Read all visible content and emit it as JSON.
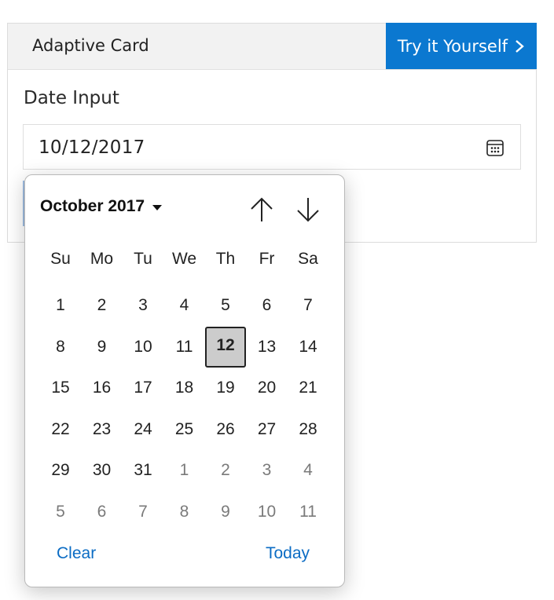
{
  "card": {
    "title": "Adaptive Card",
    "try_button": "Try it Yourself",
    "field_label": "Date Input",
    "date_value": "10/12/2017"
  },
  "picker": {
    "month_title": "October 2017",
    "weekdays": [
      "Su",
      "Mo",
      "Tu",
      "We",
      "Th",
      "Fr",
      "Sa"
    ],
    "days": [
      {
        "label": "1",
        "other": false
      },
      {
        "label": "2",
        "other": false
      },
      {
        "label": "3",
        "other": false
      },
      {
        "label": "4",
        "other": false
      },
      {
        "label": "5",
        "other": false
      },
      {
        "label": "6",
        "other": false
      },
      {
        "label": "7",
        "other": false
      },
      {
        "label": "8",
        "other": false
      },
      {
        "label": "9",
        "other": false
      },
      {
        "label": "10",
        "other": false
      },
      {
        "label": "11",
        "other": false
      },
      {
        "label": "12",
        "other": false,
        "selected": true
      },
      {
        "label": "13",
        "other": false
      },
      {
        "label": "14",
        "other": false
      },
      {
        "label": "15",
        "other": false
      },
      {
        "label": "16",
        "other": false
      },
      {
        "label": "17",
        "other": false
      },
      {
        "label": "18",
        "other": false
      },
      {
        "label": "19",
        "other": false
      },
      {
        "label": "20",
        "other": false
      },
      {
        "label": "21",
        "other": false
      },
      {
        "label": "22",
        "other": false
      },
      {
        "label": "23",
        "other": false
      },
      {
        "label": "24",
        "other": false
      },
      {
        "label": "25",
        "other": false
      },
      {
        "label": "26",
        "other": false
      },
      {
        "label": "27",
        "other": false
      },
      {
        "label": "28",
        "other": false
      },
      {
        "label": "29",
        "other": false
      },
      {
        "label": "30",
        "other": false
      },
      {
        "label": "31",
        "other": false
      },
      {
        "label": "1",
        "other": true
      },
      {
        "label": "2",
        "other": true
      },
      {
        "label": "3",
        "other": true
      },
      {
        "label": "4",
        "other": true
      },
      {
        "label": "5",
        "other": true
      },
      {
        "label": "6",
        "other": true
      },
      {
        "label": "7",
        "other": true
      },
      {
        "label": "8",
        "other": true
      },
      {
        "label": "9",
        "other": true
      },
      {
        "label": "10",
        "other": true
      },
      {
        "label": "11",
        "other": true
      }
    ],
    "clear_label": "Clear",
    "today_label": "Today",
    "icons": {
      "up": "arrow-up-icon",
      "down": "arrow-down-icon",
      "calendar": "calendar-icon",
      "caret": "caret-down-icon",
      "chevron": "chevron-right-icon"
    }
  },
  "colors": {
    "accent": "#0b78d0",
    "selected_bg": "#cccccc",
    "link": "#0b6cc4"
  }
}
